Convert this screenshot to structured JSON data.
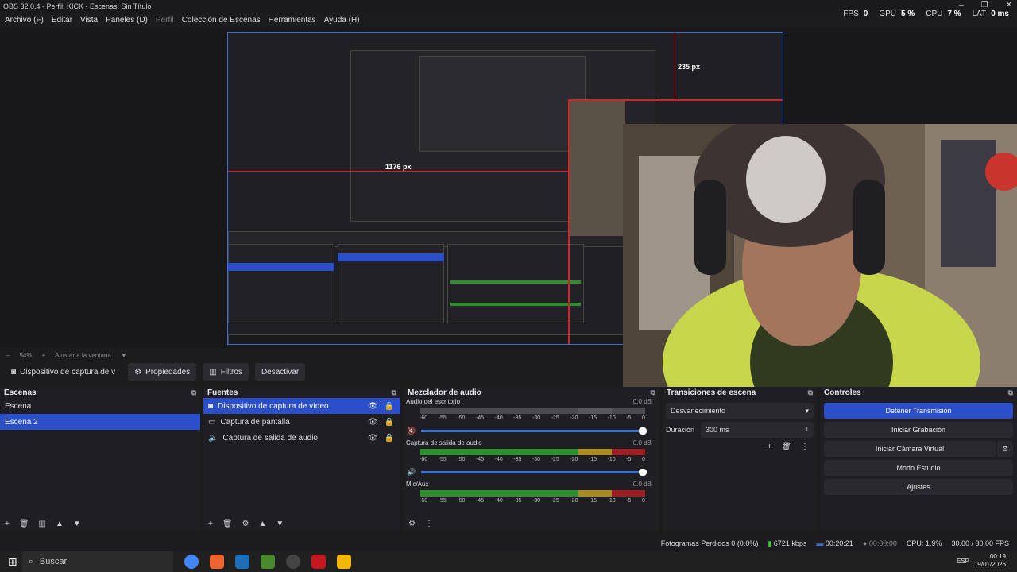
{
  "window": {
    "title": "OBS 32.0.4 - Perfil: KICK - Escenas: Sin Título"
  },
  "menu": [
    "Archivo (F)",
    "Editar",
    "Vista",
    "Paneles (D)",
    "Perfil",
    "Colección de Escenas",
    "Herramientas",
    "Ayuda (H)"
  ],
  "top_stats": {
    "fps_label": "FPS",
    "fps_value": "0",
    "gpu_label": "GPU",
    "gpu_value": "5 %",
    "cpu_label": "CPU",
    "cpu_value": "7 %",
    "lat_label": "LAT",
    "lat_value": "0 ms"
  },
  "preview": {
    "px_top": "235 px",
    "px_left": "1176 px"
  },
  "zoombar": {
    "zoom": "54%",
    "fit": "Ajustar a la ventana"
  },
  "context": {
    "source": "Dispositivo de captura de v",
    "properties": "Propiedades",
    "filters": "Filtros",
    "deactivate": "Desactivar"
  },
  "scenes": {
    "title": "Escenas",
    "items": [
      {
        "label": "Escena"
      },
      {
        "label": "Escena 2"
      }
    ]
  },
  "sources": {
    "title": "Fuentes",
    "items": [
      {
        "label": "Dispositivo de captura de vídeo"
      },
      {
        "label": "Captura de pantalla"
      },
      {
        "label": "Captura de salida de audio"
      }
    ]
  },
  "mixer": {
    "title": "Mezclador de audio",
    "ticks": [
      "-60",
      "-55",
      "-50",
      "-45",
      "-40",
      "-35",
      "-30",
      "-25",
      "-20",
      "-15",
      "-10",
      "-5",
      "0"
    ],
    "tracks": [
      {
        "name": "Audio del escritorio",
        "db": "0.0 dB"
      },
      {
        "name": "Captura de salida de audio",
        "db": "0.0 dB"
      },
      {
        "name": "Mic/Aux",
        "db": "0.0 dB"
      }
    ]
  },
  "transitions": {
    "title": "Transiciones de escena",
    "selected": "Desvanecimiento",
    "duration_label": "Duración",
    "duration_value": "300 ms"
  },
  "controls": {
    "title": "Controles",
    "buttons": [
      "Detener Transmisión",
      "Iniciar Grabación",
      "Iniciar Cámara Virtual",
      "Modo Estudio",
      "Ajustes"
    ]
  },
  "status": {
    "dropped": "Fotogramas Perdidos 0 (0.0%)",
    "bitrate": "6721 kbps",
    "stream_time": "00:20:21",
    "rec_time": "00:00:00",
    "cpu": "CPU: 1.9%",
    "fps": "30.00 / 30.00 FPS"
  },
  "taskbar": {
    "search": "Buscar",
    "lang": "ESP",
    "time": "00:19",
    "date": "19/01/2026"
  },
  "colors": {
    "accent": "#2b4ec9",
    "bounding": "#e31b23"
  }
}
